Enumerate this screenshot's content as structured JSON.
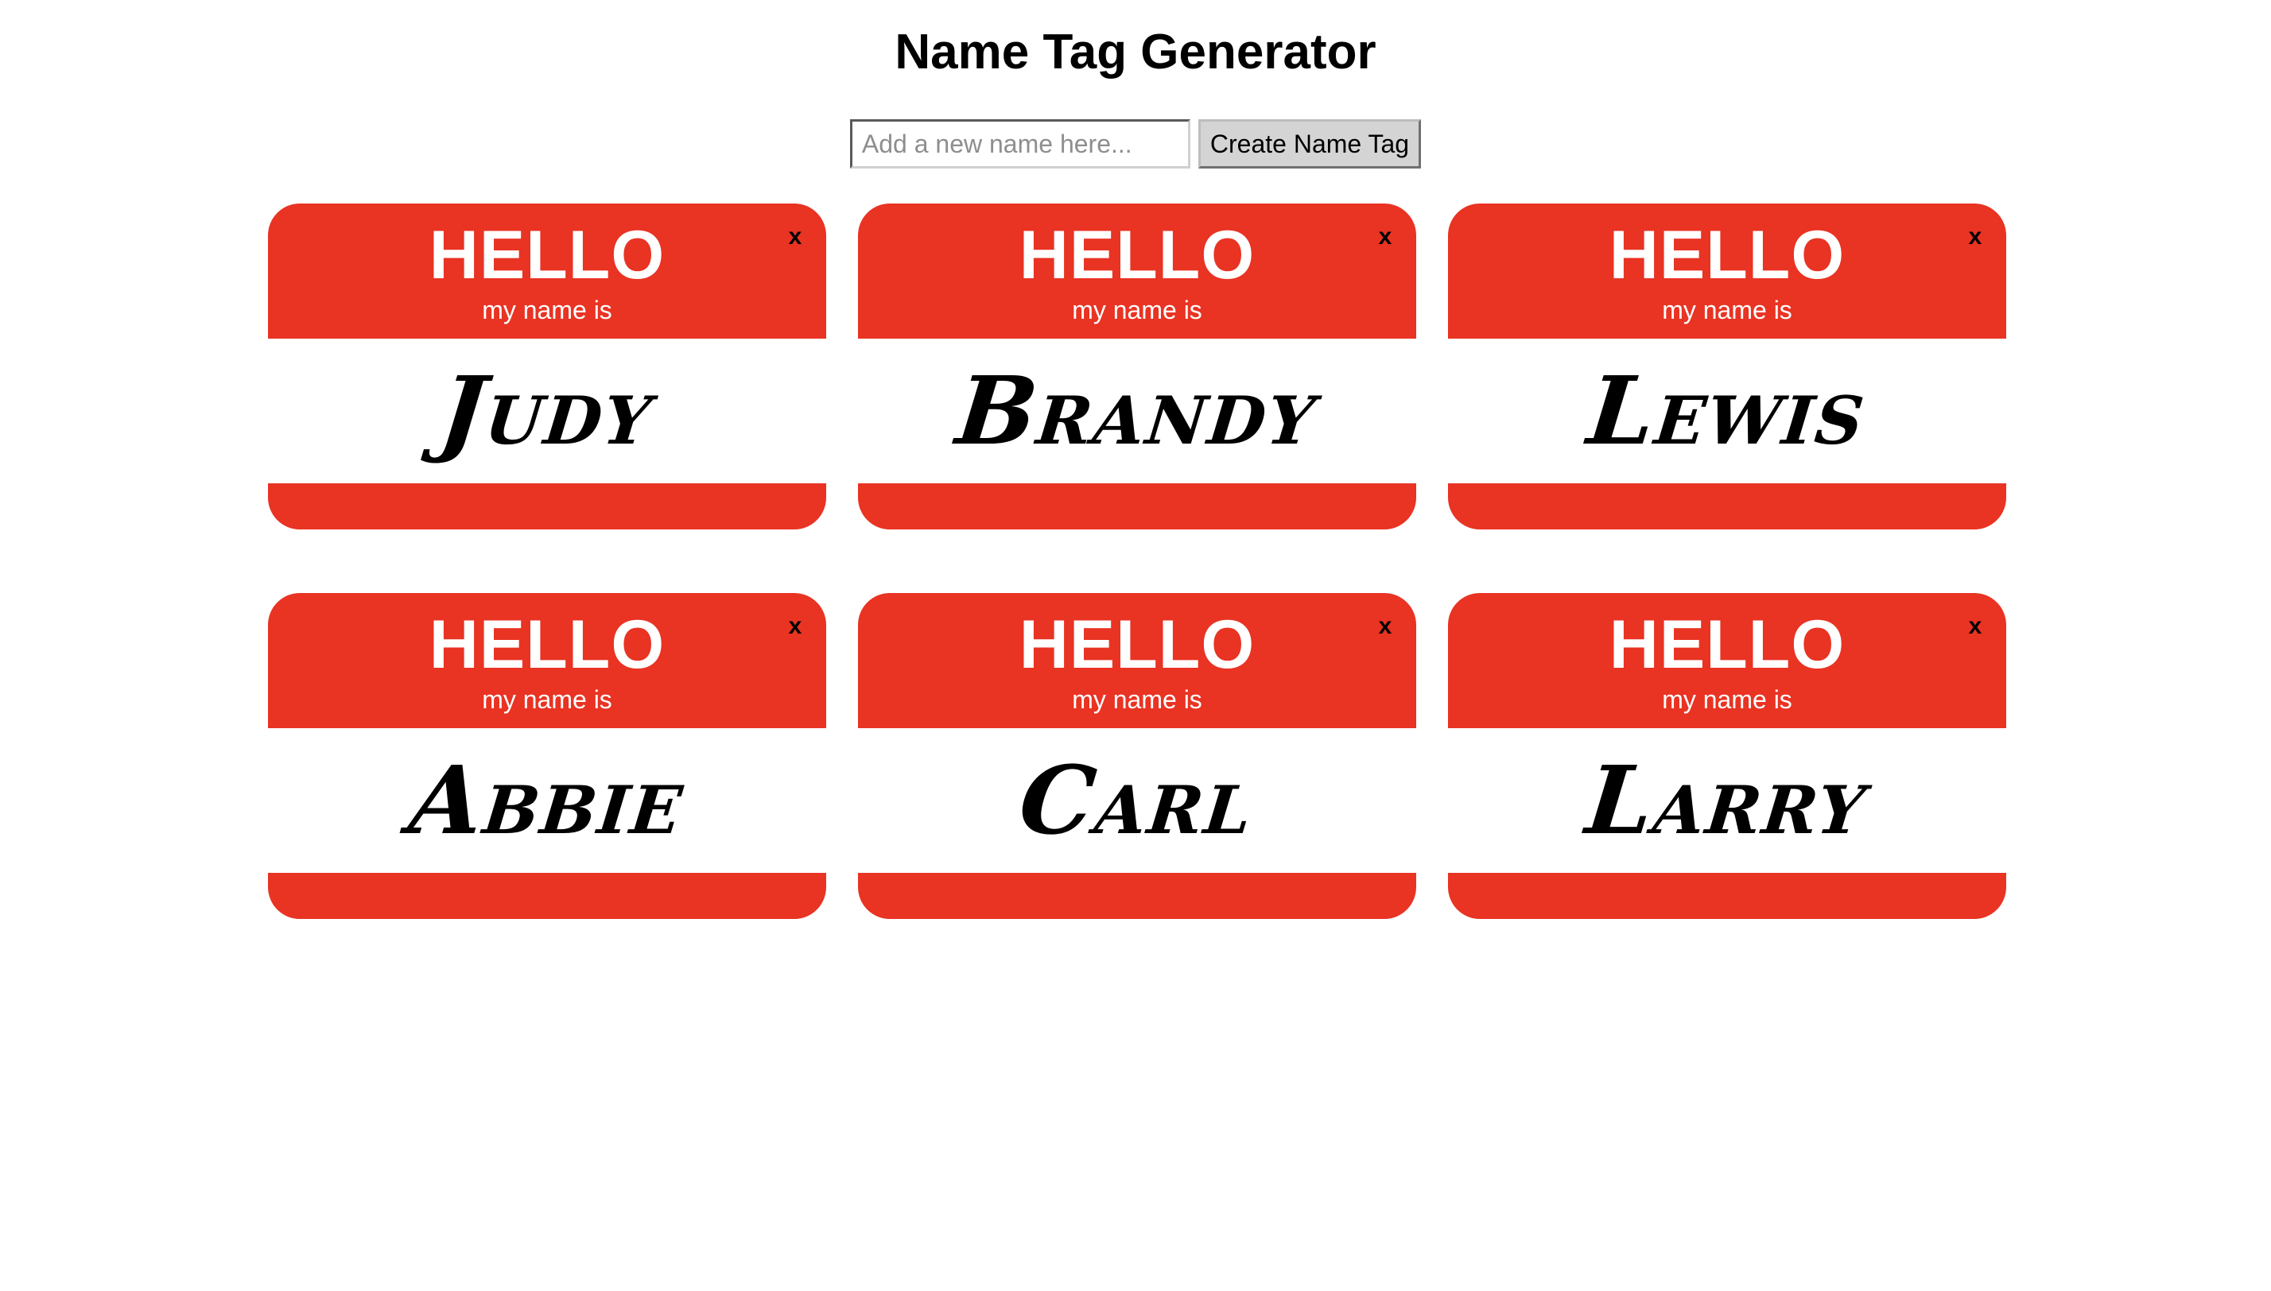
{
  "page": {
    "title": "Name Tag Generator"
  },
  "form": {
    "input_value": "",
    "input_placeholder": "Add a new name here...",
    "button_label": "Create Name Tag"
  },
  "tag_text": {
    "hello": "HELLO",
    "subtitle": "my name is",
    "close": "x"
  },
  "tags": [
    {
      "name": "Judy"
    },
    {
      "name": "Brandy"
    },
    {
      "name": "Lewis"
    },
    {
      "name": "Abbie"
    },
    {
      "name": "Carl"
    },
    {
      "name": "Larry"
    }
  ],
  "colors": {
    "tag_red": "#e93323",
    "tag_white": "#ffffff",
    "text_black": "#000000"
  }
}
